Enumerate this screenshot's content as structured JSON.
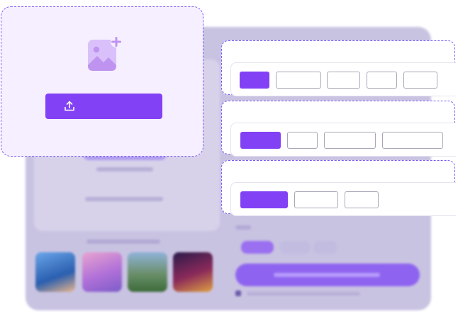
{
  "upload": {
    "icon": "image-add-icon",
    "button_icon": "upload-icon",
    "button_label": ""
  },
  "panels": [
    {
      "title": "",
      "options": [
        "",
        "",
        "",
        "",
        ""
      ],
      "selected_index": 0
    },
    {
      "title": "",
      "options": [
        "",
        "",
        "",
        ""
      ],
      "selected_index": 0
    },
    {
      "title": "",
      "options": [
        "",
        "",
        ""
      ],
      "selected_index": 0
    }
  ],
  "colors": {
    "accent": "#8241f5",
    "dashed_border": "#7a5af5",
    "upload_card_bg": "#f6efff",
    "icon_tint": "#c9a5f5"
  }
}
